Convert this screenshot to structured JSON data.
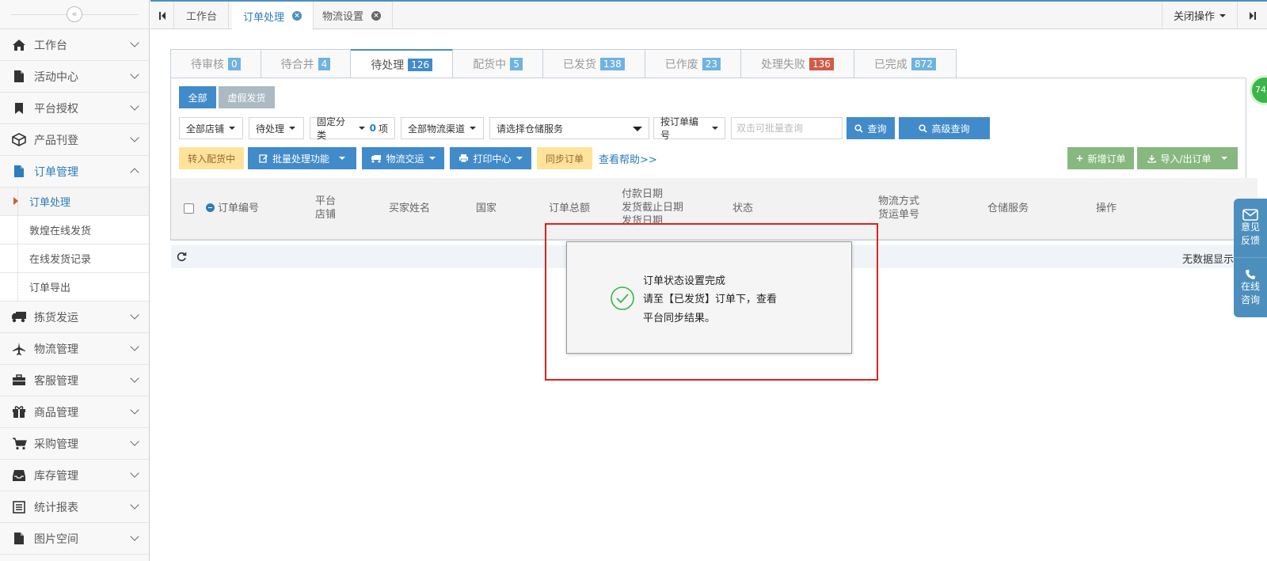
{
  "sidebar": {
    "collapse_glyph": "«",
    "items": [
      {
        "label": "工作台",
        "icon": "home-icon"
      },
      {
        "label": "活动中心",
        "icon": "file-icon"
      },
      {
        "label": "平台授权",
        "icon": "bookmark-icon"
      },
      {
        "label": "产品刊登",
        "icon": "cube-icon"
      },
      {
        "label": "订单管理",
        "icon": "file-icon"
      },
      {
        "label": "拣货发运",
        "icon": "truck-icon"
      },
      {
        "label": "物流管理",
        "icon": "plane-icon"
      },
      {
        "label": "客服管理",
        "icon": "briefcase-icon"
      },
      {
        "label": "商品管理",
        "icon": "gift-icon"
      },
      {
        "label": "采购管理",
        "icon": "cart-icon"
      },
      {
        "label": "库存管理",
        "icon": "inbox-icon"
      },
      {
        "label": "统计报表",
        "icon": "list-icon"
      },
      {
        "label": "图片空间",
        "icon": "file-icon"
      }
    ],
    "sub_items": [
      "订单处理",
      "敦煌在线发货",
      "在线发货记录",
      "订单导出"
    ]
  },
  "topbar": {
    "tabs": [
      {
        "label": "工作台"
      },
      {
        "label": "订单处理"
      },
      {
        "label": "物流设置"
      }
    ],
    "close_ops": "关闭操作"
  },
  "status_tabs": [
    {
      "label": "待审核",
      "count": "0",
      "color": "#6fb3e0"
    },
    {
      "label": "待合并",
      "count": "4",
      "color": "#6fb3e0"
    },
    {
      "label": "待处理",
      "count": "126",
      "color": "#428bca"
    },
    {
      "label": "配货中",
      "count": "5",
      "color": "#6fb3e0"
    },
    {
      "label": "已发货",
      "count": "138",
      "color": "#6fb3e0"
    },
    {
      "label": "已作废",
      "count": "23",
      "color": "#6fb3e0"
    },
    {
      "label": "处理失败",
      "count": "136",
      "color": "#d15b47"
    },
    {
      "label": "已完成",
      "count": "872",
      "color": "#6fb3e0"
    }
  ],
  "filters": {
    "all_btn": "全部",
    "virtual_btn": "虚假发货",
    "shop_select": "全部店铺",
    "status_select": "待处理",
    "category_select": "固定分类",
    "category_count": "0",
    "category_unit": "项",
    "channel_select": "全部物流渠道",
    "warehouse_select": "请选择仓储服务",
    "order_no_select": "按订单编号",
    "search_placeholder": "双击可批量查询",
    "query_btn": "查询",
    "adv_query_btn": "高级查询"
  },
  "actions": {
    "to_picking": "转入配货中",
    "batch": "批量处理功能",
    "logistics": "物流交运",
    "print": "打印中心",
    "sync": "同步订单",
    "help": "查看帮助>>",
    "new_order": "新增订单",
    "import_export": "导入/出订单"
  },
  "table": {
    "headers": {
      "order_no": "订单编号",
      "platform": "平台",
      "shop": "店铺",
      "buyer": "买家姓名",
      "country": "国家",
      "total": "订单总额",
      "pay_date": "付款日期",
      "ship_deadline": "发货截止日期",
      "ship_date": "发货日期",
      "status": "状态",
      "logistics_method": "物流方式",
      "tracking_no": "货运单号",
      "warehouse": "仓储服务",
      "ops": "操作"
    },
    "empty_text": "无数据显示"
  },
  "modal": {
    "title": "订单状态设置完成",
    "line1": "请至【已发货】订单下，查看",
    "line2": "平台同步结果。"
  },
  "float_panel": {
    "feedback_1": "意见",
    "feedback_2": "反馈",
    "consult_1": "在线",
    "consult_2": "咨询",
    "ball_text": "74"
  },
  "colors": {
    "accent": "#4c8fbd",
    "highlight_border": "#e02020",
    "success": "#3bb54a"
  }
}
